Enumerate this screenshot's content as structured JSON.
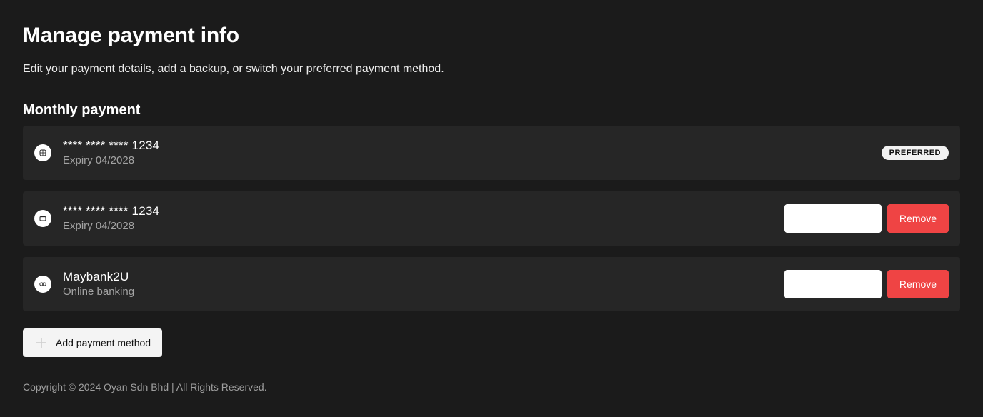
{
  "header": {
    "title": "Manage payment info",
    "subtitle": "Edit your payment details, add a backup, or switch your preferred payment method."
  },
  "section": {
    "title": "Monthly payment"
  },
  "methods": [
    {
      "icon": "card-chip-icon",
      "name": "**** **** **** 1234",
      "detail": "Expiry 04/2028",
      "badge": "PREFERRED"
    },
    {
      "icon": "credit-card-icon",
      "name": "**** **** **** 1234",
      "detail": "Expiry 04/2028",
      "set_preferred_label": "",
      "remove_label": "Remove"
    },
    {
      "icon": "bank-link-icon",
      "name": "Maybank2U",
      "detail": "Online banking",
      "set_preferred_label": "",
      "remove_label": "Remove"
    }
  ],
  "add_button": {
    "label": "Add payment method",
    "icon": "plus-icon"
  },
  "footer": {
    "copyright": "Copyright © 2024 Oyan Sdn Bhd | All Rights Reserved."
  },
  "colors": {
    "background": "#1b1b1b",
    "card": "#262626",
    "danger": "#ef4444",
    "badge_bg": "#f2f2f2",
    "muted_text": "#a3a3a3"
  }
}
